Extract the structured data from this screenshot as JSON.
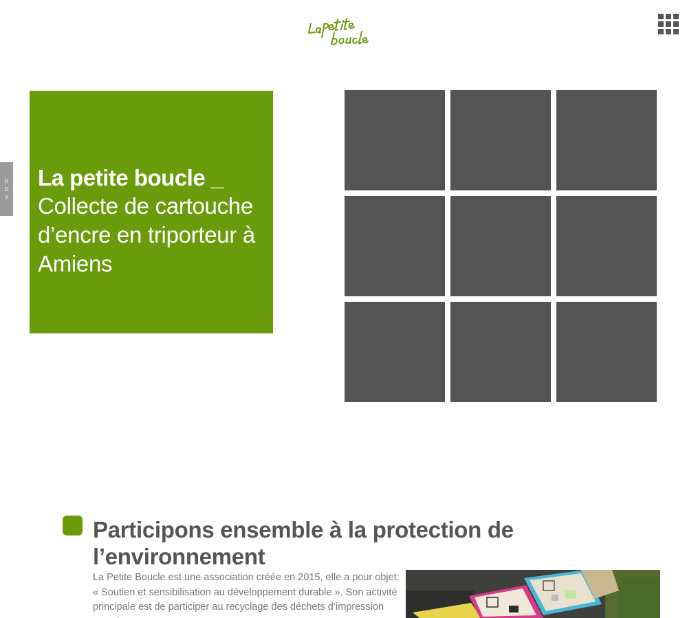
{
  "header": {
    "logo_text": "La petite boucle",
    "menu_icon": "grid-menu-icon"
  },
  "side_tab": {
    "letters": [
      "R",
      "D",
      "V"
    ]
  },
  "hero": {
    "title": "La petite boucle _",
    "subtitle": "Collecte de cartouche d’encre en triporteur à Amiens"
  },
  "tiles": {
    "count": 9
  },
  "section": {
    "title": "Participons ensemble à la protection de l’environnement",
    "text": "La Petite Boucle est une association créée en 2015, elle a pour objet: « Soutien et sensibilisation au développement durable ». Son activité principale est de participer au recyclage des déchets d’impression usagés"
  },
  "colors": {
    "brand_green": "#6a9b0a",
    "tile_gray": "#545454",
    "text_gray": "#555555"
  }
}
